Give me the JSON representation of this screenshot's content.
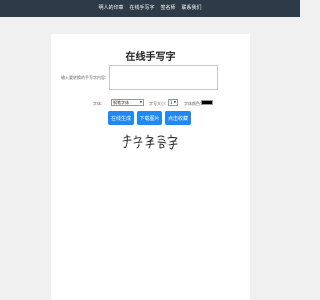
{
  "nav": {
    "items": [
      "明人的印章",
      "在线手写字",
      "签名师",
      "联系我们"
    ]
  },
  "page": {
    "title": "在线手写字"
  },
  "form": {
    "text_label": "输入要转换的手写字内容:",
    "textarea_value": "",
    "font_label": "字体:",
    "font_value": "钢笔字体",
    "size_label": "字号大小:",
    "size_value": "1",
    "color_label": "字体颜色:",
    "color_value": "#000000"
  },
  "buttons": {
    "generate": "在线生成",
    "download": "下载图片",
    "collect": "点击收藏"
  },
  "preview": {
    "text": "手写字签字"
  }
}
